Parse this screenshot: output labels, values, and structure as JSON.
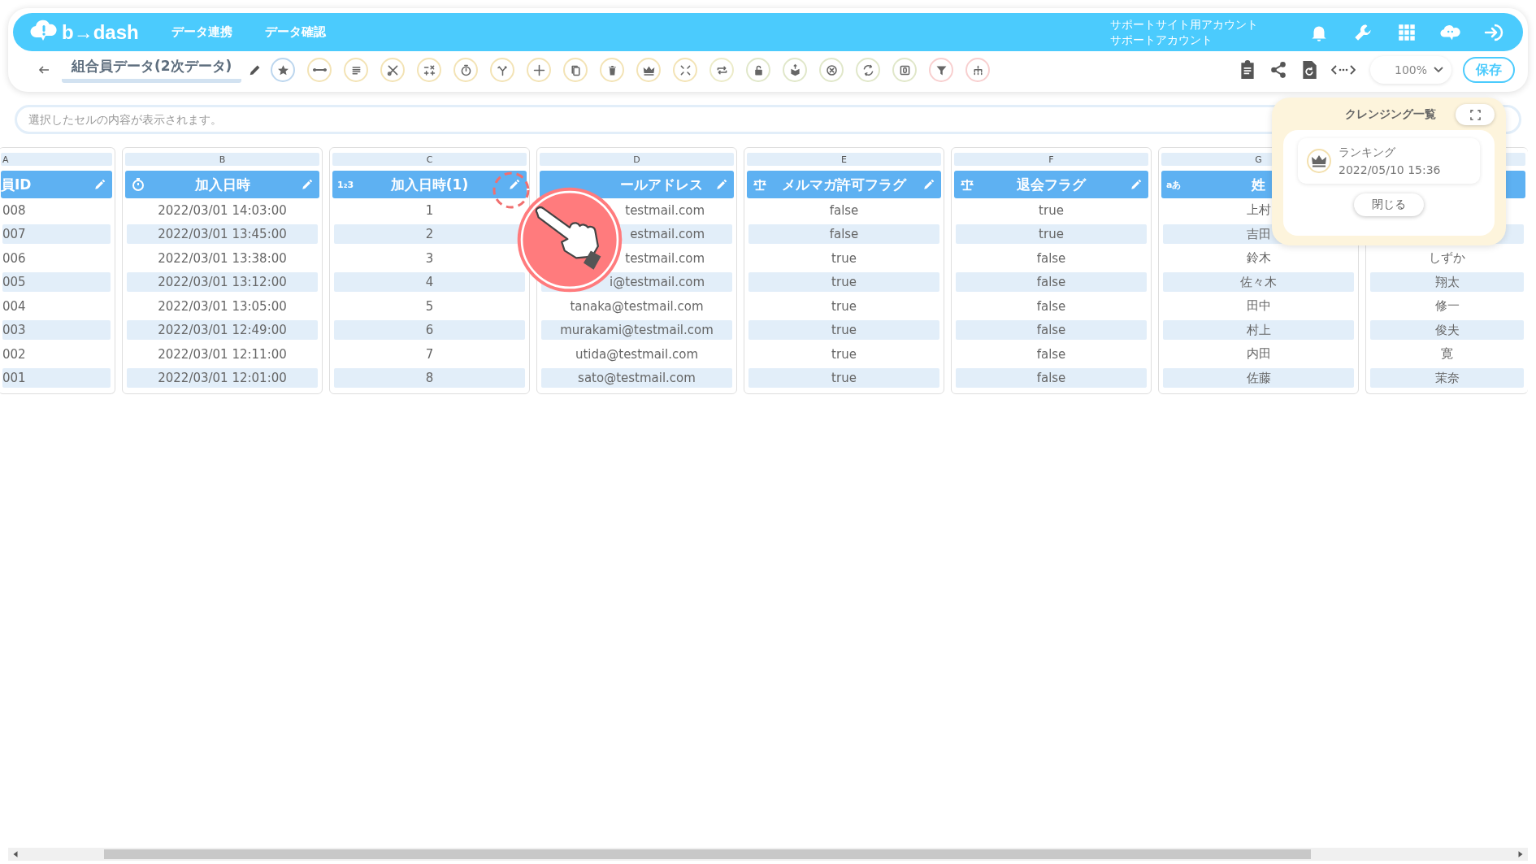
{
  "app": {
    "logo_text": "b→dash",
    "nav": [
      {
        "label": "データ連携"
      },
      {
        "label": "データ確認"
      }
    ],
    "account": {
      "line_1": "サポートサイト用アカウント",
      "line_2": "サポートアカウント"
    }
  },
  "toolbar": {
    "title": "組合員データ(2次データ)",
    "zoom": "100%",
    "save": "保存"
  },
  "cell_viewer": {
    "placeholder": "選択したセルの内容が表示されます。"
  },
  "columns": [
    {
      "letter": "A",
      "title": "員ID",
      "editable": true,
      "cells": [
        "008",
        "007",
        "006",
        "005",
        "004",
        "003",
        "002",
        "001"
      ]
    },
    {
      "letter": "B",
      "title": "加入日時",
      "kind": "datetime",
      "editable": true,
      "cells": [
        "2022/03/01 14:03:00",
        "2022/03/01 13:45:00",
        "2022/03/01 13:38:00",
        "2022/03/01 13:12:00",
        "2022/03/01 13:05:00",
        "2022/03/01 12:49:00",
        "2022/03/01 12:11:00",
        "2022/03/01 12:01:00"
      ]
    },
    {
      "letter": "C",
      "title": "加入日時(1)",
      "kind": "number",
      "type_label": "1₂3",
      "editable": true,
      "cells": [
        "1",
        "2",
        "3",
        "4",
        "5",
        "6",
        "7",
        "8"
      ]
    },
    {
      "letter": "D",
      "title": "ールアドレス",
      "editable": true,
      "cells": [
        "testmail.com",
        "estmail.com",
        "testmail.com",
        "i@testmail.com",
        "tanaka@testmail.com",
        "murakami@testmail.com",
        "utida@testmail.com",
        "sato@testmail.com"
      ]
    },
    {
      "letter": "E",
      "title": "メルマガ許可フラグ",
      "kind": "boolean",
      "editable": true,
      "cells": [
        "false",
        "false",
        "true",
        "true",
        "true",
        "true",
        "true",
        "true"
      ]
    },
    {
      "letter": "F",
      "title": "退会フラグ",
      "kind": "boolean",
      "editable": true,
      "cells": [
        "true",
        "true",
        "false",
        "false",
        "false",
        "false",
        "false",
        "false"
      ]
    },
    {
      "letter": "G",
      "title": "姓",
      "kind": "text",
      "type_label": "aあ",
      "editable": false,
      "cells": [
        "上村",
        "吉田",
        "鈴木",
        "佐々木",
        "田中",
        "村上",
        "内田",
        "佐藤"
      ]
    },
    {
      "cells": [
        null,
        null,
        "しずか",
        "翔太",
        "修一",
        "俊夫",
        "寛",
        "茉奈"
      ]
    }
  ],
  "cleansing_panel": {
    "title": "クレンジング一覧",
    "items": [
      {
        "name": "ランキング",
        "time": "2022/05/10 15:36"
      }
    ],
    "close": "閉じる"
  }
}
